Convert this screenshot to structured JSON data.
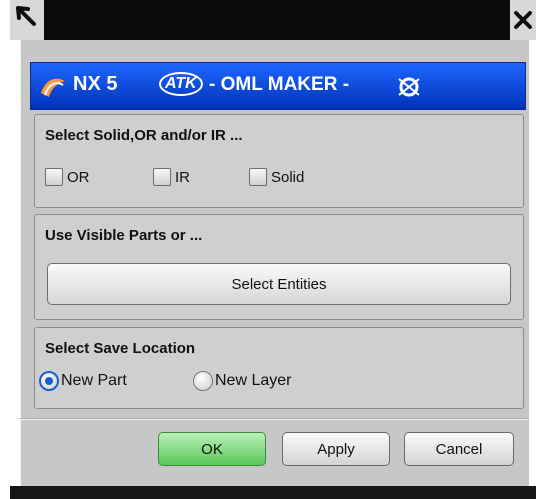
{
  "window": {
    "title_icon": "cursor-arrow-icon",
    "close_icon": "close-x-icon"
  },
  "banner": {
    "product": "NX 5",
    "badge": "ATK",
    "title": "- OML MAKER -",
    "logo_icon": "nx-logo-icon",
    "emblem_icon": "emblem-icon",
    "gradient_top": "#1f66ff",
    "gradient_bottom": "#0033b8"
  },
  "select_group": {
    "label": "Select Solid,OR and/or IR ...",
    "options": [
      "OR",
      "IR",
      "Solid"
    ]
  },
  "visible_group": {
    "label": "Use Visible Parts or ...",
    "button_label": "Select Entities"
  },
  "save_group": {
    "label": "Select Save Location",
    "options": [
      "New Part",
      "New Layer"
    ],
    "selected": "New Part"
  },
  "footer": {
    "ok": "OK",
    "apply": "Apply",
    "cancel": "Cancel",
    "ok_color": "#58c858"
  }
}
